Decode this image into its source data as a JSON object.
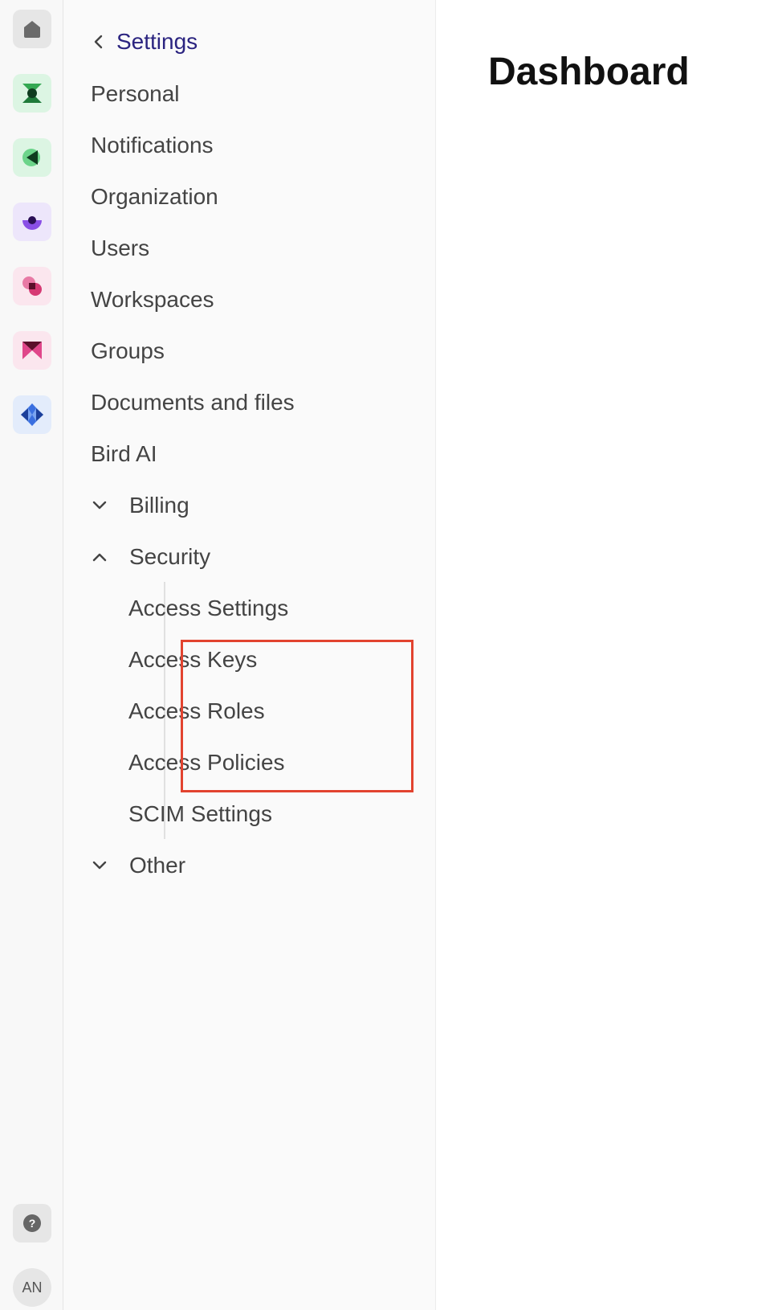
{
  "rail": {
    "apps": [
      {
        "icon": "home-icon",
        "bg": "#e6e6e6"
      },
      {
        "icon": "contacts-app-icon",
        "bg": "#dcf5e3"
      },
      {
        "icon": "channels-app-icon",
        "bg": "#dcf5e3"
      },
      {
        "icon": "inbox-app-icon",
        "bg": "#ede6fb"
      },
      {
        "icon": "marketing-app-icon",
        "bg": "#fbe6ee"
      },
      {
        "icon": "automation-app-icon",
        "bg": "#fbe6ee"
      },
      {
        "icon": "developer-app-icon",
        "bg": "#e3ecfb"
      }
    ],
    "help_icon": "help-icon",
    "avatar_initials": "AN"
  },
  "sidebar": {
    "back_label": "Settings",
    "items": [
      {
        "label": "Personal"
      },
      {
        "label": "Notifications"
      },
      {
        "label": "Organization"
      },
      {
        "label": "Users"
      },
      {
        "label": "Workspaces"
      },
      {
        "label": "Groups"
      },
      {
        "label": "Documents and files"
      },
      {
        "label": "Bird AI"
      }
    ],
    "billing": {
      "label": "Billing",
      "expanded": false
    },
    "security": {
      "label": "Security",
      "expanded": true,
      "children": [
        {
          "label": "Access Settings"
        },
        {
          "label": "Access Keys"
        },
        {
          "label": "Access Roles"
        },
        {
          "label": "Access Policies"
        },
        {
          "label": "SCIM Settings"
        }
      ]
    },
    "other": {
      "label": "Other",
      "expanded": false
    }
  },
  "main": {
    "title": "Dashboard"
  },
  "colors": {
    "accent_link": "#2b2480",
    "highlight": "#e2432f"
  }
}
